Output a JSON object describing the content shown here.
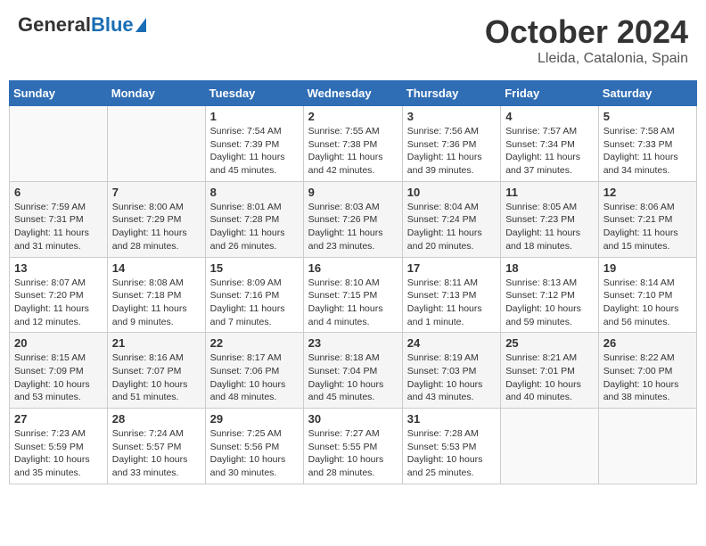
{
  "header": {
    "logo_general": "General",
    "logo_blue": "Blue",
    "main_title": "October 2024",
    "subtitle": "Lleida, Catalonia, Spain"
  },
  "weekdays": [
    "Sunday",
    "Monday",
    "Tuesday",
    "Wednesday",
    "Thursday",
    "Friday",
    "Saturday"
  ],
  "weeks": [
    [
      {
        "day": "",
        "info": ""
      },
      {
        "day": "",
        "info": ""
      },
      {
        "day": "1",
        "info": "Sunrise: 7:54 AM\nSunset: 7:39 PM\nDaylight: 11 hours and 45 minutes."
      },
      {
        "day": "2",
        "info": "Sunrise: 7:55 AM\nSunset: 7:38 PM\nDaylight: 11 hours and 42 minutes."
      },
      {
        "day": "3",
        "info": "Sunrise: 7:56 AM\nSunset: 7:36 PM\nDaylight: 11 hours and 39 minutes."
      },
      {
        "day": "4",
        "info": "Sunrise: 7:57 AM\nSunset: 7:34 PM\nDaylight: 11 hours and 37 minutes."
      },
      {
        "day": "5",
        "info": "Sunrise: 7:58 AM\nSunset: 7:33 PM\nDaylight: 11 hours and 34 minutes."
      }
    ],
    [
      {
        "day": "6",
        "info": "Sunrise: 7:59 AM\nSunset: 7:31 PM\nDaylight: 11 hours and 31 minutes."
      },
      {
        "day": "7",
        "info": "Sunrise: 8:00 AM\nSunset: 7:29 PM\nDaylight: 11 hours and 28 minutes."
      },
      {
        "day": "8",
        "info": "Sunrise: 8:01 AM\nSunset: 7:28 PM\nDaylight: 11 hours and 26 minutes."
      },
      {
        "day": "9",
        "info": "Sunrise: 8:03 AM\nSunset: 7:26 PM\nDaylight: 11 hours and 23 minutes."
      },
      {
        "day": "10",
        "info": "Sunrise: 8:04 AM\nSunset: 7:24 PM\nDaylight: 11 hours and 20 minutes."
      },
      {
        "day": "11",
        "info": "Sunrise: 8:05 AM\nSunset: 7:23 PM\nDaylight: 11 hours and 18 minutes."
      },
      {
        "day": "12",
        "info": "Sunrise: 8:06 AM\nSunset: 7:21 PM\nDaylight: 11 hours and 15 minutes."
      }
    ],
    [
      {
        "day": "13",
        "info": "Sunrise: 8:07 AM\nSunset: 7:20 PM\nDaylight: 11 hours and 12 minutes."
      },
      {
        "day": "14",
        "info": "Sunrise: 8:08 AM\nSunset: 7:18 PM\nDaylight: 11 hours and 9 minutes."
      },
      {
        "day": "15",
        "info": "Sunrise: 8:09 AM\nSunset: 7:16 PM\nDaylight: 11 hours and 7 minutes."
      },
      {
        "day": "16",
        "info": "Sunrise: 8:10 AM\nSunset: 7:15 PM\nDaylight: 11 hours and 4 minutes."
      },
      {
        "day": "17",
        "info": "Sunrise: 8:11 AM\nSunset: 7:13 PM\nDaylight: 11 hours and 1 minute."
      },
      {
        "day": "18",
        "info": "Sunrise: 8:13 AM\nSunset: 7:12 PM\nDaylight: 10 hours and 59 minutes."
      },
      {
        "day": "19",
        "info": "Sunrise: 8:14 AM\nSunset: 7:10 PM\nDaylight: 10 hours and 56 minutes."
      }
    ],
    [
      {
        "day": "20",
        "info": "Sunrise: 8:15 AM\nSunset: 7:09 PM\nDaylight: 10 hours and 53 minutes."
      },
      {
        "day": "21",
        "info": "Sunrise: 8:16 AM\nSunset: 7:07 PM\nDaylight: 10 hours and 51 minutes."
      },
      {
        "day": "22",
        "info": "Sunrise: 8:17 AM\nSunset: 7:06 PM\nDaylight: 10 hours and 48 minutes."
      },
      {
        "day": "23",
        "info": "Sunrise: 8:18 AM\nSunset: 7:04 PM\nDaylight: 10 hours and 45 minutes."
      },
      {
        "day": "24",
        "info": "Sunrise: 8:19 AM\nSunset: 7:03 PM\nDaylight: 10 hours and 43 minutes."
      },
      {
        "day": "25",
        "info": "Sunrise: 8:21 AM\nSunset: 7:01 PM\nDaylight: 10 hours and 40 minutes."
      },
      {
        "day": "26",
        "info": "Sunrise: 8:22 AM\nSunset: 7:00 PM\nDaylight: 10 hours and 38 minutes."
      }
    ],
    [
      {
        "day": "27",
        "info": "Sunrise: 7:23 AM\nSunset: 5:59 PM\nDaylight: 10 hours and 35 minutes."
      },
      {
        "day": "28",
        "info": "Sunrise: 7:24 AM\nSunset: 5:57 PM\nDaylight: 10 hours and 33 minutes."
      },
      {
        "day": "29",
        "info": "Sunrise: 7:25 AM\nSunset: 5:56 PM\nDaylight: 10 hours and 30 minutes."
      },
      {
        "day": "30",
        "info": "Sunrise: 7:27 AM\nSunset: 5:55 PM\nDaylight: 10 hours and 28 minutes."
      },
      {
        "day": "31",
        "info": "Sunrise: 7:28 AM\nSunset: 5:53 PM\nDaylight: 10 hours and 25 minutes."
      },
      {
        "day": "",
        "info": ""
      },
      {
        "day": "",
        "info": ""
      }
    ]
  ]
}
